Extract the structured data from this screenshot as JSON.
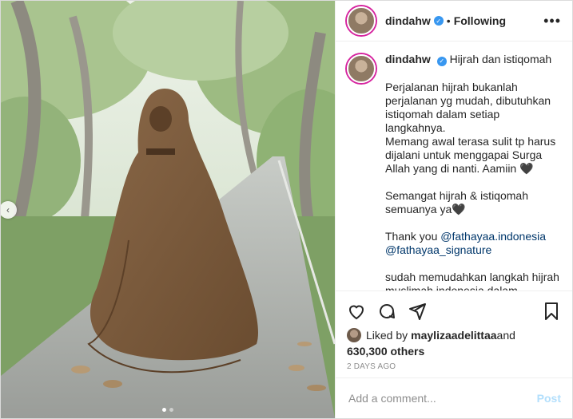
{
  "header": {
    "username": "dindahw",
    "separator": "•",
    "follow_status": "Following",
    "more_label": "•••"
  },
  "caption": {
    "username": "dindahw",
    "title": "Hijrah dan istiqomah",
    "paragraph1": "Perjalanan hijrah bukanlah\nperjalanan yg mudah, dibutuhkan\nistiqomah dalam setiap langkahnya.\nMemang awal terasa sulit tp harus\ndijalani untuk menggapai Surga\nAllah yang di nanti. Aamiin 🖤",
    "paragraph2": "Semangat hijrah & istiqomah\nsemuanya ya🖤",
    "thanks_prefix": "Thank you ",
    "mention1": "@fathayaa.indonesia",
    "mention2": "@fathayaa_signature",
    "paragraph4": "sudah memudahkan langkah hijrah\nmuslimah indonesia dalam berhijrah\nmemakai pakaian syari seperti yg\naku pakai ini dengan harga hemat"
  },
  "likes": {
    "liked_by_prefix": "Liked by ",
    "liked_by_user": "maylizaadelittaa",
    "and_label": " and",
    "others_count": "630,300 others"
  },
  "date": "2 DAYS AGO",
  "add_comment": {
    "placeholder": "Add a comment...",
    "post_label": "Post"
  },
  "carousel": {
    "prev_label": "‹",
    "slide_count": 2,
    "active_slide": 1
  },
  "colors": {
    "verified": "#3897f0",
    "link": "#00376b",
    "post_disabled": "#b2dffc",
    "date": "#8e8e8e",
    "garment": "#7a5a3a"
  },
  "icons": [
    "heart-icon",
    "comment-icon",
    "share-icon",
    "bookmark-icon",
    "verified-badge-icon",
    "more-options-icon",
    "chevron-left-icon"
  ]
}
